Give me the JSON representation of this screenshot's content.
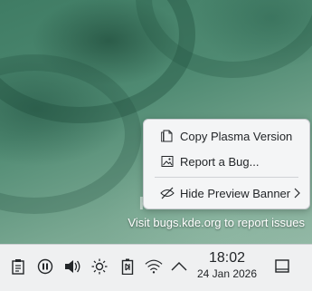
{
  "watermark": {
    "title": "KDE Plasma 6 Beta",
    "subtitle": "Visit bugs.kde.org to report issues"
  },
  "context_menu": {
    "items": [
      {
        "label": "Copy Plasma Version",
        "icon": "copy-document-icon"
      },
      {
        "label": "Report a Bug...",
        "icon": "image-bug-icon"
      },
      {
        "label": "Hide Preview Banner",
        "icon": "hide-eye-icon",
        "submenu": true
      }
    ]
  },
  "panel": {
    "tray_icons": [
      "clipboard-icon",
      "media-pause-icon",
      "volume-icon",
      "brightness-icon",
      "battery-icon",
      "wifi-icon",
      "tray-expand-arrow-icon"
    ],
    "clock": {
      "time": "18:02",
      "date": "24 Jan 2026"
    },
    "show_desktop_icon": "show-desktop-icon"
  },
  "colors": {
    "menu_bg": "#f4f5f6",
    "panel_bg": "#eff0f1",
    "text": "#232629",
    "wallpaper": "#4f8a72"
  }
}
